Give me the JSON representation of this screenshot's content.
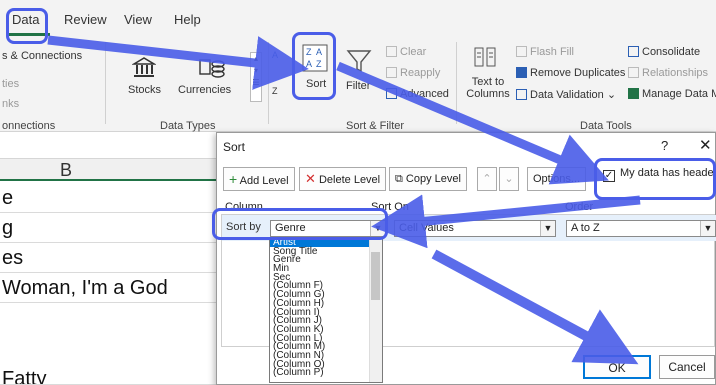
{
  "ribbon": {
    "tabs": [
      "Data",
      "Review",
      "View",
      "Help"
    ],
    "groups": {
      "connections": {
        "items": [
          "s & Connections",
          "ties",
          "nks"
        ],
        "label": "onnections"
      },
      "data_types": {
        "stocks": "Stocks",
        "currencies": "Currencies",
        "label": "Data Types"
      },
      "sort_filter": {
        "az": "A",
        "za": "Z",
        "sort": "Sort",
        "filter": "Filter",
        "clear": "Clear",
        "reapply": "Reapply",
        "advanced": "Advanced",
        "label": "Sort & Filter"
      },
      "data_tools": {
        "text_to_columns": "Text to Columns",
        "flash_fill": "Flash Fill",
        "remove_duplicates": "Remove Duplicates",
        "data_validation": "Data Validation",
        "consolidate": "Consolidate",
        "relationships": "Relationships",
        "manage_data_model": "Manage Data M",
        "label": "Data Tools"
      }
    }
  },
  "sheet": {
    "column_header": "B",
    "cells": [
      "e",
      "g",
      "es",
      "Woman, I'm a God",
      "Fatty"
    ]
  },
  "dialog": {
    "title": "Sort",
    "help": "?",
    "close": "✕",
    "toolbar": {
      "add_level": "Add Level",
      "delete_level": "Delete Level",
      "copy_level": "Copy Level",
      "options": "Options...",
      "my_data_has_headers": "My data has headers"
    },
    "headers": {
      "column": "Column",
      "sort_on": "Sort On",
      "order": "Order"
    },
    "row": {
      "label": "Sort by",
      "column_value": "Genre",
      "sort_on_value": "Cell Values",
      "order_value": "A to Z"
    },
    "dropdown_options": [
      "Artist",
      "Song Title",
      "Genre",
      "Min",
      "Sec",
      "(Column F)",
      "(Column G)",
      "(Column H)",
      "(Column I)",
      "(Column J)",
      "(Column K)",
      "(Column L)",
      "(Column M)",
      "(Column N)",
      "(Column O)",
      "(Column P)"
    ],
    "ok": "OK",
    "cancel": "Cancel",
    "headers_checked": true
  },
  "colors": {
    "annotation": "#4a5de8",
    "excel_green": "#217346",
    "selection_blue": "#0078d7"
  }
}
